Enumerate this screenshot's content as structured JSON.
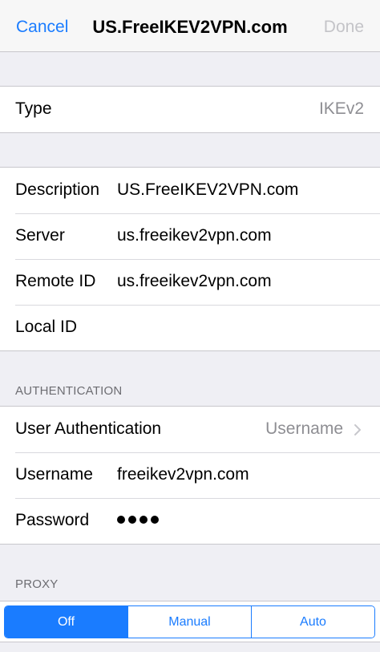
{
  "navbar": {
    "cancel_label": "Cancel",
    "title": "US.FreeIKEV2VPN.com",
    "done_label": "Done"
  },
  "type_row": {
    "label": "Type",
    "value": "IKEv2"
  },
  "connection": {
    "description": {
      "label": "Description",
      "value": "US.FreeIKEV2VPN.com"
    },
    "server": {
      "label": "Server",
      "value": "us.freeikev2vpn.com"
    },
    "remote_id": {
      "label": "Remote ID",
      "value": "us.freeikev2vpn.com"
    },
    "local_id": {
      "label": "Local ID",
      "value": ""
    }
  },
  "authentication": {
    "header": "AUTHENTICATION",
    "user_auth": {
      "label": "User Authentication",
      "value": "Username"
    },
    "username": {
      "label": "Username",
      "value": "freeikev2vpn.com"
    },
    "password": {
      "label": "Password",
      "masked_length": 4
    }
  },
  "proxy": {
    "header": "PROXY",
    "options": [
      "Off",
      "Manual",
      "Auto"
    ],
    "selected": "Off"
  },
  "colors": {
    "accent": "#1a7cff",
    "disabled": "#c4c4c8",
    "secondary_text": "#8e8e93",
    "background": "#efeff4"
  },
  "icons": {
    "disclosure": "chevron-right-icon"
  }
}
